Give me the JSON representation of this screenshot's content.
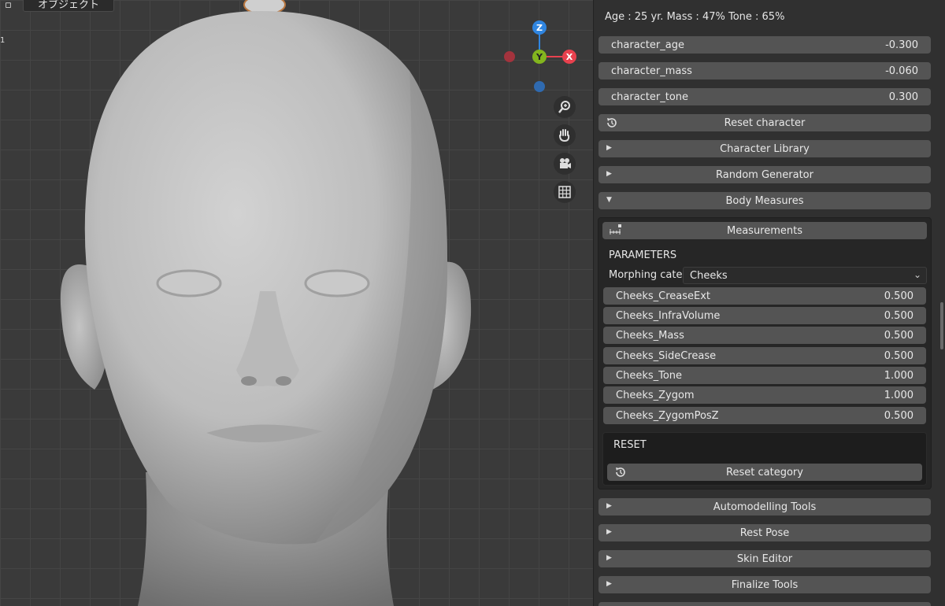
{
  "viewport": {
    "header_label": "オブジェクト",
    "side_number": "1"
  },
  "gizmo": {
    "z": "Z",
    "y": "Y",
    "x": "X",
    "colors": {
      "x": "#e8414e",
      "y": "#83b51e",
      "z": "#2f85e0"
    }
  },
  "nav_icons": [
    "zoom-icon",
    "hand-pan-icon",
    "camera-icon",
    "grid-icon"
  ],
  "panel": {
    "info": "Age : 25 yr.  Mass : 47%  Tone : 65%",
    "fields": [
      {
        "label": "character_age",
        "value": "-0.300"
      },
      {
        "label": "character_mass",
        "value": "-0.060"
      },
      {
        "label": "character_tone",
        "value": "0.300"
      }
    ],
    "reset_character": "Reset character",
    "sections": {
      "character_library": "Character Library",
      "random_generator": "Random Generator",
      "body_measures": "Body Measures"
    },
    "measurements_button": "Measurements",
    "parameters_heading": "PARAMETERS",
    "morphing_label": "Morphing cate..",
    "morphing_value": "Cheeks",
    "params": [
      {
        "label": "Cheeks_CreaseExt",
        "value": "0.500"
      },
      {
        "label": "Cheeks_InfraVolume",
        "value": "0.500"
      },
      {
        "label": "Cheeks_Mass",
        "value": "0.500"
      },
      {
        "label": "Cheeks_SideCrease",
        "value": "0.500"
      },
      {
        "label": "Cheeks_Tone",
        "value": "1.000"
      },
      {
        "label": "Cheeks_Zygom",
        "value": "1.000"
      },
      {
        "label": "Cheeks_ZygomPosZ",
        "value": "0.500"
      }
    ],
    "reset_heading": "RESET",
    "reset_category": "Reset category",
    "more_sections": {
      "automodelling": "Automodelling Tools",
      "rest_pose": "Rest Pose",
      "skin_editor": "Skin Editor",
      "finalize": "Finalize Tools"
    }
  }
}
